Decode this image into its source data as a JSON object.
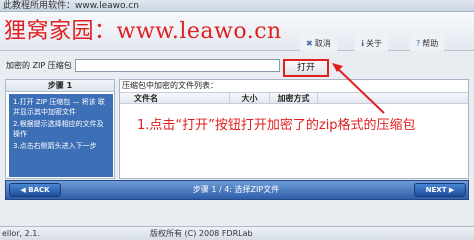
{
  "window": {
    "title": "此教程所用软件：www.leawo.cn"
  },
  "toolbar": {
    "watermark": "狸窝家园：www.leawo.cn",
    "btn_1": "取消",
    "btn_2": "关于",
    "btn_3": "帮助"
  },
  "zip": {
    "label": "加密的 ZIP 压缩包",
    "value": "",
    "open_button": "打开"
  },
  "steps": {
    "header": "步骤 1",
    "items": [
      "1.打开 ZIP 压缩包 — 将该 联并显示其中加密文件",
      "2.根据提示选择相应的文件及操作",
      "3.点击右侧箭头进入下一步"
    ]
  },
  "filelist": {
    "caption": "压缩包中加密的文件列表：",
    "columns": [
      "文件名",
      "大小",
      "加密方式"
    ]
  },
  "annotation": "1.点击“打开”按钮打开加密了的zip格式的压缩包",
  "nav": {
    "back": "BACK",
    "next": "NEXT",
    "step_label": "步骤 1 / 4: 选择ZIP文件"
  },
  "status": {
    "left": "ellor, 2.1.",
    "center": "版权所有 (C) 2008 FDRLab"
  }
}
